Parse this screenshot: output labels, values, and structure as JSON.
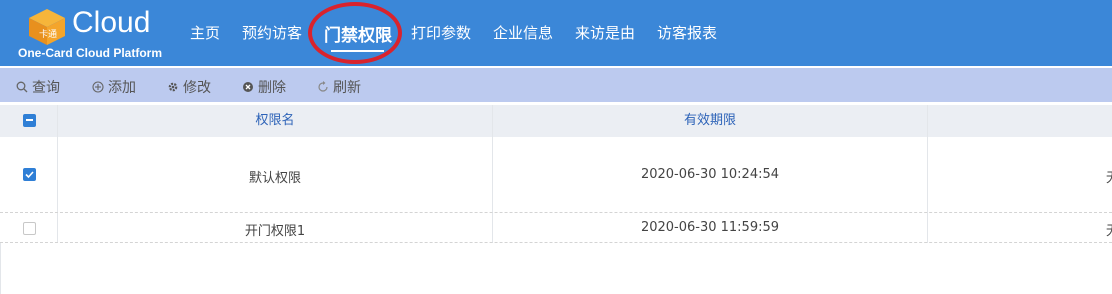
{
  "app": {
    "logo_text": "Cloud",
    "logo_subtitle": "One-Card Cloud Platform",
    "logo_mark_text": "卡通"
  },
  "nav": {
    "items": [
      {
        "label": "主页"
      },
      {
        "label": "预约访客"
      },
      {
        "label": "门禁权限",
        "active": true
      },
      {
        "label": "打印参数"
      },
      {
        "label": "企业信息"
      },
      {
        "label": "来访是由"
      },
      {
        "label": "访客报表"
      }
    ]
  },
  "toolbar": {
    "query_label": "查询",
    "add_label": "添加",
    "edit_label": "修改",
    "delete_label": "删除",
    "refresh_label": "刷新"
  },
  "table": {
    "columns": [
      "权限名",
      "有效期限"
    ],
    "rows": [
      {
        "name": "默认权限",
        "expiry": "2020-06-30 10:24:54",
        "checked": true,
        "extra": "无"
      },
      {
        "name": "开门权限1",
        "expiry": "2020-06-30 11:59:59",
        "checked": false,
        "extra": "无"
      }
    ]
  },
  "colors": {
    "header_bg": "#3b87d8",
    "toolbar_bg": "#bccaef",
    "highlight_circle": "#d9232d",
    "checkbox_blue": "#2f7fd6"
  }
}
